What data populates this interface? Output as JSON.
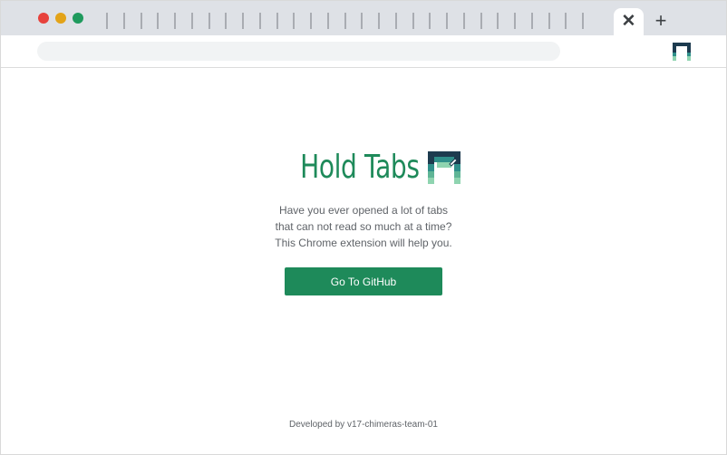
{
  "browser": {
    "window_controls": [
      "close",
      "minimize",
      "maximize"
    ],
    "tab_close_icon": "close-icon",
    "new_tab_icon": "plus-icon",
    "close_glyph": "✕",
    "plus_glyph": "+",
    "inactive_tab_count": 29,
    "omnibox_value": ""
  },
  "extension": {
    "icon": "hold-tabs-logo-icon"
  },
  "page": {
    "title": "Hold Tabs",
    "tagline": [
      "Have you ever opened a lot of tabs",
      "that can not read so much at a time?",
      "This Chrome extension will help you."
    ],
    "cta_label": "Go To GitHub",
    "footer": "Developed by v17-chimeras-team-01"
  },
  "colors": {
    "brand_green": "#1e8a5a",
    "logo_navy": "#1d3b4f",
    "logo_teal": "#2f8f8a",
    "logo_light": "#8fd4b0",
    "tabstrip": "#dee1e6",
    "text_muted": "#5f6368",
    "dot_red": "#e7423c",
    "dot_yellow": "#e3a318",
    "dot_green": "#1f9a5d"
  }
}
